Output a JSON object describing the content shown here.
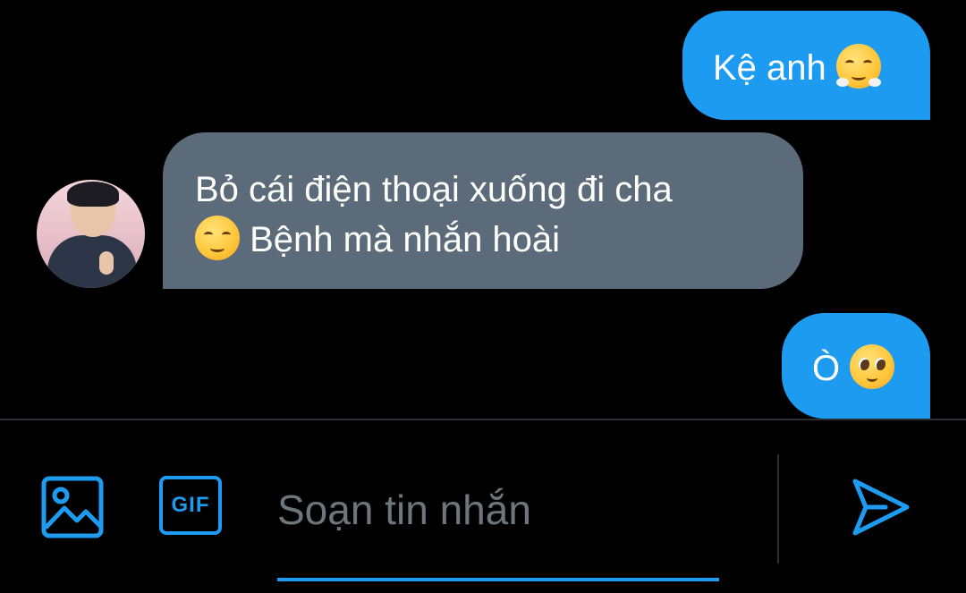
{
  "messages": [
    {
      "direction": "outgoing",
      "text": "Kệ anh",
      "emoji": "face-with-steam-from-nose"
    },
    {
      "direction": "incoming",
      "text": "Bỏ cái điện thoại xuống đi cha",
      "emoji": "relieved-face",
      "text2": "Bệnh mà nhắn hoài"
    },
    {
      "direction": "outgoing",
      "text": "Ò",
      "emoji": "pleading-face"
    }
  ],
  "compose": {
    "placeholder": "Soạn tin nhắn",
    "value": "",
    "gif_label": "GIF"
  },
  "icons": {
    "image": "image-icon",
    "gif": "gif-icon",
    "send": "send-icon"
  },
  "colors": {
    "background": "#000000",
    "outgoing_bubble": "#1d9bf0",
    "incoming_bubble": "#5b6b79",
    "accent": "#1d9bf0",
    "placeholder": "#6e767d"
  }
}
